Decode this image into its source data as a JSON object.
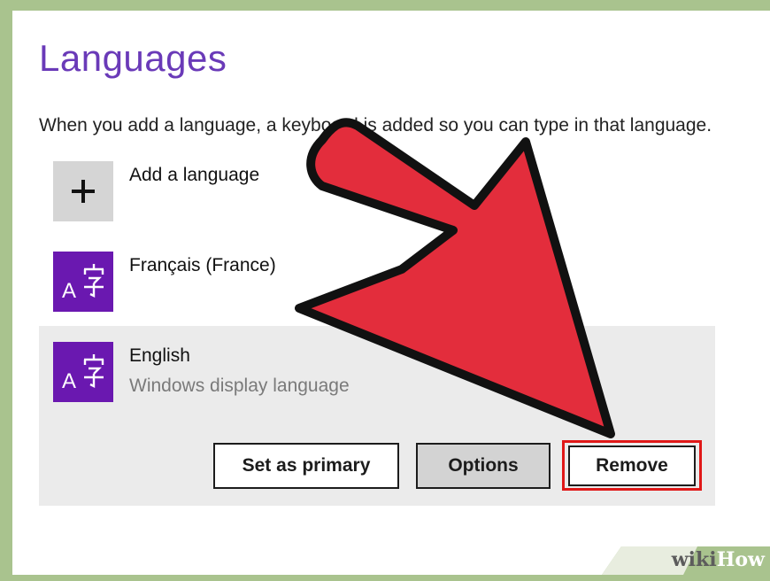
{
  "page": {
    "title": "Languages",
    "description": "When you add a language, a keyboard is added so you can type in that language."
  },
  "languages": {
    "add_label": "Add a language",
    "items": [
      {
        "name": "Français (France)",
        "subtitle": ""
      },
      {
        "name": "English",
        "subtitle": "Windows display language"
      }
    ]
  },
  "actions": {
    "set_primary": "Set as primary",
    "options": "Options",
    "remove": "Remove"
  },
  "icons": {
    "add": "plus-icon",
    "language": "language-icon",
    "callout": "arrow-pointer"
  },
  "colors": {
    "title": "#6a3ab8",
    "language_tile": "#6a18b0",
    "selected_row": "#ebebeb",
    "highlight": "#e01818",
    "arrow_fill": "#e32d3c",
    "frame": "#a9c38e"
  },
  "watermark": {
    "prefix": "wiki",
    "suffix": "How"
  }
}
